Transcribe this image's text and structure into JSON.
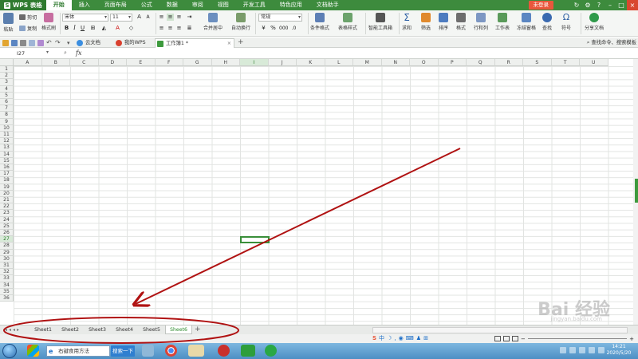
{
  "app": {
    "logo": "WPS 表格",
    "menu_tabs": [
      "开始",
      "插入",
      "页面布局",
      "公式",
      "数据",
      "审阅",
      "视图",
      "开发工具",
      "特色应用",
      "文档助手"
    ],
    "active_menu": "开始",
    "login_label": "未登录"
  },
  "ribbon": {
    "paste_label": "粘贴",
    "cut_label": "剪切",
    "copy_label": "复制",
    "format_painter_label": "格式刷",
    "font_name": "宋体",
    "font_size": "11",
    "bold": "B",
    "italic": "I",
    "underline": "U",
    "merge_label": "合并居中",
    "wrap_label": "自动换行",
    "number_format": "常规",
    "conditional_label": "条件格式",
    "table_style_label": "表格样式",
    "smart_toolbox_label": "智能工具箱",
    "sum_label": "求和",
    "filter_label": "筛选",
    "sort_label": "排序",
    "format_label": "格式",
    "rowcol_label": "行和列",
    "sheet_label": "工作表",
    "freeze_label": "冻结窗格",
    "find_label": "查找",
    "symbol_label": "符号",
    "share_label": "分享文档"
  },
  "doc_tabs": {
    "items": [
      "云文档",
      "我的WPS",
      "工作簿1 *"
    ],
    "active": "工作簿1 *",
    "help_text": "查找命令、搜索模板"
  },
  "formula_bar": {
    "name_box": "I27",
    "fx": "fx"
  },
  "grid": {
    "columns": [
      "A",
      "B",
      "C",
      "D",
      "E",
      "F",
      "G",
      "H",
      "I",
      "J",
      "K",
      "L",
      "M",
      "N",
      "O",
      "P",
      "Q",
      "R",
      "S",
      "T",
      "U"
    ],
    "rows": [
      "1",
      "2",
      "3",
      "4",
      "5",
      "6",
      "7",
      "8",
      "9",
      "10",
      "11",
      "12",
      "13",
      "14",
      "15",
      "16",
      "17",
      "18",
      "19",
      "20",
      "21",
      "22",
      "23",
      "24",
      "25",
      "26",
      "27",
      "28",
      "29",
      "30",
      "31",
      "32",
      "33",
      "34",
      "35",
      "36"
    ],
    "selected_column": "I",
    "selected_row": "27"
  },
  "sheets": {
    "items": [
      "Sheet1",
      "Sheet2",
      "Sheet3",
      "Sheet4",
      "Sheet5",
      "Sheet6"
    ],
    "active": "Sheet6",
    "add_label": "+"
  },
  "status": {
    "ime_label": "S",
    "ime_lang": "中"
  },
  "taskbar": {
    "search_text": "右键食用方法",
    "search_button": "搜索一下",
    "time": "14:21",
    "date": "2020/5/20"
  },
  "annotation": {
    "arrow_color": "#b01212",
    "ellipse_color": "#b01212"
  },
  "watermark": {
    "text": "Bai 经验",
    "sub": "jingyan.baidu.com"
  },
  "colors": {
    "accent": "#3d8b3d",
    "active_cell_border": "#3a8f3a"
  }
}
